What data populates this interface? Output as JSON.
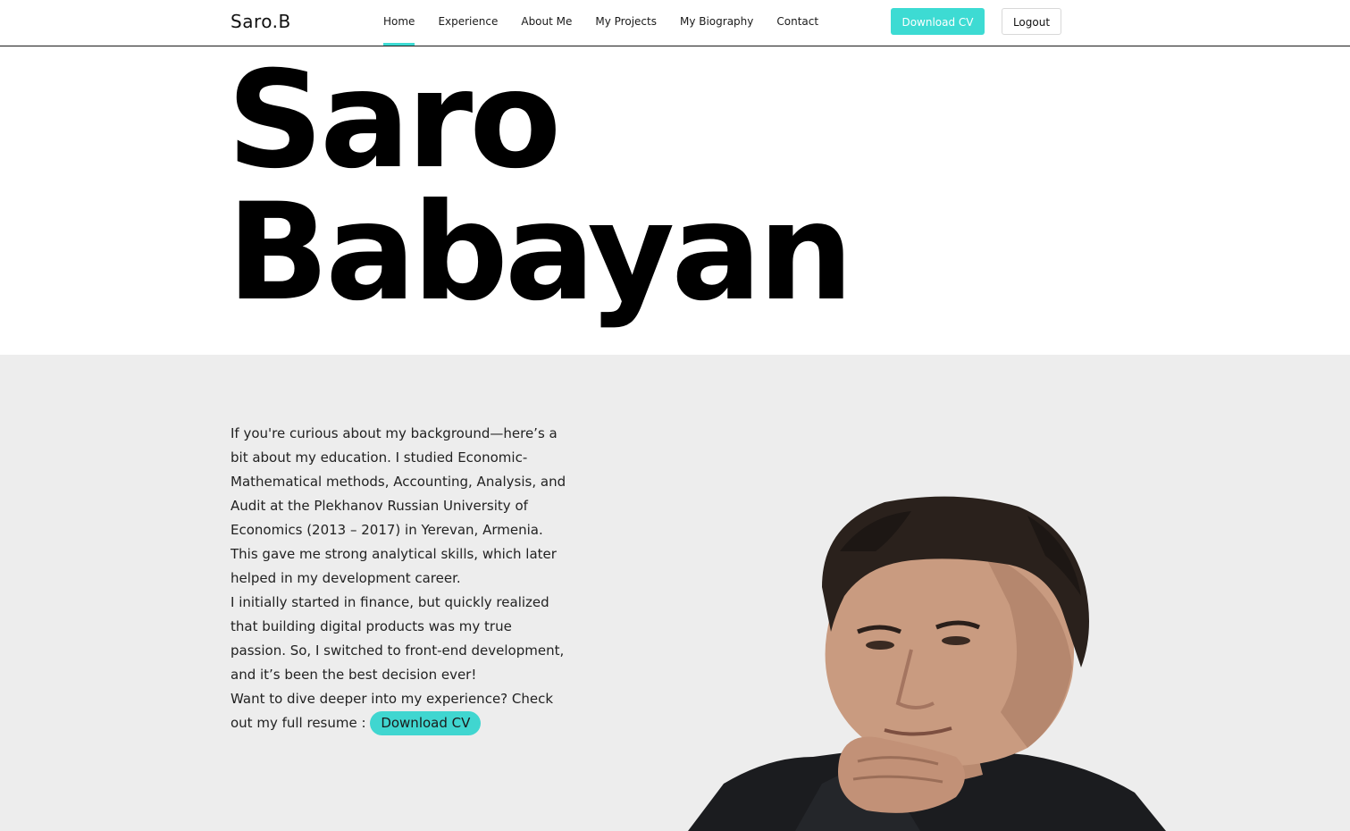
{
  "nav": {
    "logo": "Saro.B",
    "links": [
      {
        "label": "Home",
        "active": true
      },
      {
        "label": "Experience",
        "active": false
      },
      {
        "label": "About Me",
        "active": false
      },
      {
        "label": "My Projects",
        "active": false
      },
      {
        "label": "My Biography",
        "active": false
      },
      {
        "label": "Contact",
        "active": false
      }
    ],
    "download_label": "Download CV",
    "logout_label": "Logout"
  },
  "hero": {
    "first_name": "Saro",
    "last_name": "Babayan"
  },
  "bio": {
    "paragraph1": "If you're curious about my background—here’s a bit about my education. I studied Economic-Mathematical methods, Accounting, Analysis, and Audit at the Plekhanov Russian University of Economics (2013 – 2017) in Yerevan, Armenia. This gave me strong analytical skills, which later helped in my development career.",
    "paragraph2": "I initially started in finance, but quickly realized that building digital products was my true passion. So, I switched to front-end development, and it’s been the best decision ever!",
    "paragraph3": "Want to dive deeper into my experience? Check out my full resume :",
    "download_label": "Download CV"
  },
  "colors": {
    "accent": "#3ddbd3",
    "section_bg": "#ededed",
    "text": "#111111"
  }
}
